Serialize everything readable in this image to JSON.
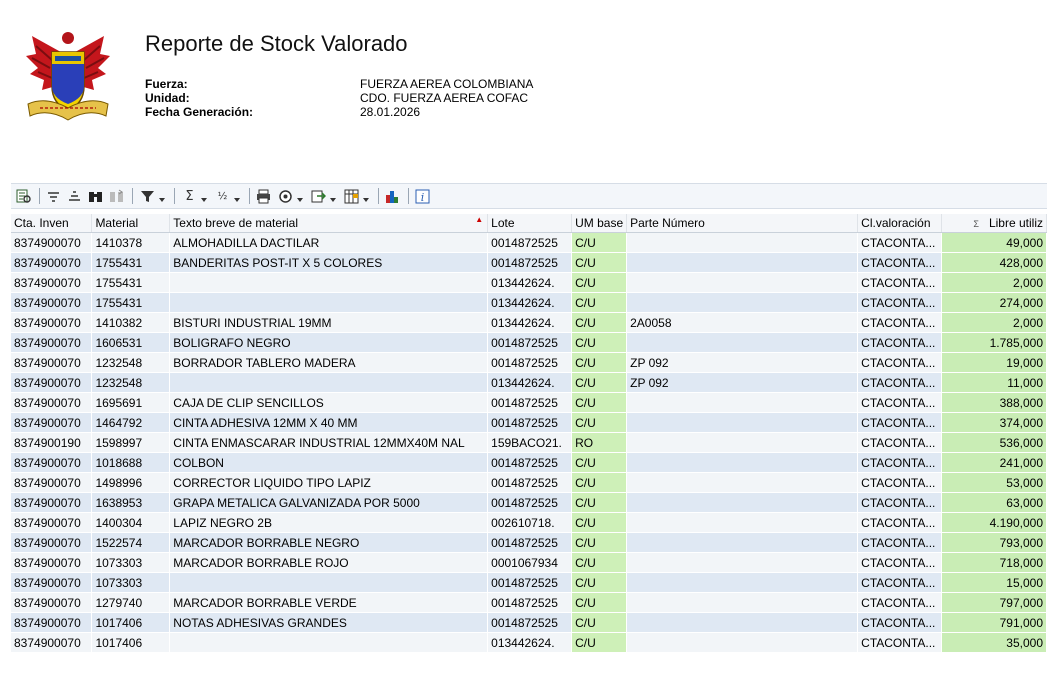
{
  "header": {
    "title": "Reporte de Stock Valorado",
    "fields": [
      {
        "label": "Fuerza:",
        "value": "FUERZA AEREA COLOMBIANA"
      },
      {
        "label": "Unidad:",
        "value": "CDO. FUERZA AEREA COFAC"
      },
      {
        "label": "Fecha Generación:",
        "value": " 28.01.2026"
      }
    ]
  },
  "toolbar": {
    "buttons": [
      "details-icon",
      "sort-ascending-icon",
      "sort-descending-icon",
      "find-icon",
      "find-next-icon",
      "filter-icon",
      "sum-icon",
      "subtotal-icon",
      "print-icon",
      "view-icon",
      "export-icon",
      "layout-icon",
      "graphic-icon",
      "info-icon"
    ]
  },
  "colors": {
    "um_column": "#cef0b8",
    "libre_column": "#c9edb5",
    "row_odd": "#f2f5f8",
    "row_even": "#dfe8f3"
  },
  "table": {
    "headers": [
      "Cta. Inven",
      "Material",
      "Texto breve de material",
      "Lote",
      "UM base",
      "Parte Número",
      "Cl.valoración",
      "Libre utiliz"
    ],
    "sum_marker": "Σ",
    "rows": [
      [
        "8374900070",
        "1410378",
        "ALMOHADILLA DACTILAR",
        "0014872525",
        "C/U",
        "",
        "CTACONTA...",
        "49,000"
      ],
      [
        "8374900070",
        "1755431",
        "BANDERITAS POST-IT X 5 COLORES",
        "0014872525",
        "C/U",
        "",
        "CTACONTA...",
        "428,000"
      ],
      [
        "8374900070",
        "1755431",
        "",
        "013442624.",
        "C/U",
        "",
        "CTACONTA...",
        "2,000"
      ],
      [
        "8374900070",
        "1755431",
        "",
        "013442624.",
        "C/U",
        "",
        "CTACONTA...",
        "274,000"
      ],
      [
        "8374900070",
        "1410382",
        "BISTURI INDUSTRIAL 19MM",
        "013442624.",
        "C/U",
        "2A0058",
        "CTACONTA...",
        "2,000"
      ],
      [
        "8374900070",
        "1606531",
        "BOLIGRAFO NEGRO",
        "0014872525",
        "C/U",
        "",
        "CTACONTA...",
        "1.785,000"
      ],
      [
        "8374900070",
        "1232548",
        "BORRADOR TABLERO MADERA",
        "0014872525",
        "C/U",
        "ZP 092",
        "CTACONTA...",
        "19,000"
      ],
      [
        "8374900070",
        "1232548",
        "",
        "013442624.",
        "C/U",
        "ZP 092",
        "CTACONTA...",
        "11,000"
      ],
      [
        "8374900070",
        "1695691",
        "CAJA DE CLIP SENCILLOS",
        "0014872525",
        "C/U",
        "",
        "CTACONTA...",
        "388,000"
      ],
      [
        "8374900070",
        "1464792",
        "CINTA ADHESIVA  12MM X 40 MM",
        "0014872525",
        "C/U",
        "",
        "CTACONTA...",
        "374,000"
      ],
      [
        "8374900190",
        "1598997",
        "CINTA ENMASCARAR INDUSTRIAL 12MMX40M NAL",
        "159BACO21.",
        "RO",
        "",
        "CTACONTA...",
        "536,000"
      ],
      [
        "8374900070",
        "1018688",
        "COLBON",
        "0014872525",
        "C/U",
        "",
        "CTACONTA...",
        "241,000"
      ],
      [
        "8374900070",
        "1498996",
        "CORRECTOR LIQUIDO TIPO LAPIZ",
        "0014872525",
        "C/U",
        "",
        "CTACONTA...",
        "53,000"
      ],
      [
        "8374900070",
        "1638953",
        "GRAPA METALICA GALVANIZADA POR 5000",
        "0014872525",
        "C/U",
        "",
        "CTACONTA...",
        "63,000"
      ],
      [
        "8374900070",
        "1400304",
        "LAPIZ NEGRO 2B",
        "002610718.",
        "C/U",
        "",
        "CTACONTA...",
        "4.190,000"
      ],
      [
        "8374900070",
        "1522574",
        "MARCADOR BORRABLE NEGRO",
        "0014872525",
        "C/U",
        "",
        "CTACONTA...",
        "793,000"
      ],
      [
        "8374900070",
        "1073303",
        "MARCADOR BORRABLE ROJO",
        "0001067934",
        "C/U",
        "",
        "CTACONTA...",
        "718,000"
      ],
      [
        "8374900070",
        "1073303",
        "",
        "0014872525",
        "C/U",
        "",
        "CTACONTA...",
        "15,000"
      ],
      [
        "8374900070",
        "1279740",
        "MARCADOR BORRABLE VERDE",
        "0014872525",
        "C/U",
        "",
        "CTACONTA...",
        "797,000"
      ],
      [
        "8374900070",
        "1017406",
        "NOTAS ADHESIVAS GRANDES",
        "0014872525",
        "C/U",
        "",
        "CTACONTA...",
        "791,000"
      ],
      [
        "8374900070",
        "1017406",
        "",
        "013442624.",
        "C/U",
        "",
        "CTACONTA...",
        "35,000"
      ]
    ]
  }
}
